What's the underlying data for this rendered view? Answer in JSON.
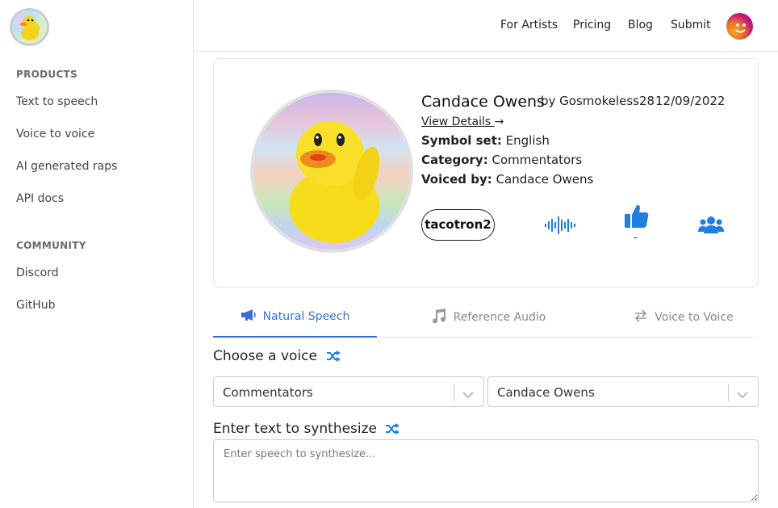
{
  "sidebar": {
    "logo_icon": "duck-logo-icon",
    "products_title": "PRODUCTS",
    "products": [
      "Text to speech",
      "Voice to voice",
      "AI generated raps",
      "API docs"
    ],
    "community_title": "COMMUNITY",
    "community": [
      "Discord",
      "GitHub"
    ]
  },
  "topnav": {
    "links": [
      "For Artists",
      "Pricing",
      "Blog",
      "Submit"
    ],
    "avatar_icon": "user-avatar-icon"
  },
  "voice": {
    "name": "Candace Owens",
    "by": "by Gosmokeless28",
    "date": "12/09/2022",
    "view_details": "View Details",
    "symbol_label": "Symbol set:",
    "symbol_value": "English",
    "category_label": "Category:",
    "category_value": "Commentators",
    "voiced_label": "Voiced by:",
    "voiced_value": "Candace Owens",
    "model": "tacotron2",
    "like_count": "-",
    "accent": "#1e7fe0"
  },
  "tabs": [
    {
      "label": "Natural Speech",
      "icon": "megaphone-icon",
      "active": true
    },
    {
      "label": "Reference Audio",
      "icon": "music-note-icon",
      "active": false
    },
    {
      "label": "Voice to Voice",
      "icon": "swap-arrows-icon",
      "active": false
    }
  ],
  "choose": {
    "label": "Choose a voice",
    "category_value": "Commentators",
    "voice_value": "Candace Owens"
  },
  "synth": {
    "label": "Enter text to synthesize",
    "placeholder": "Enter speech to synthesize..."
  }
}
